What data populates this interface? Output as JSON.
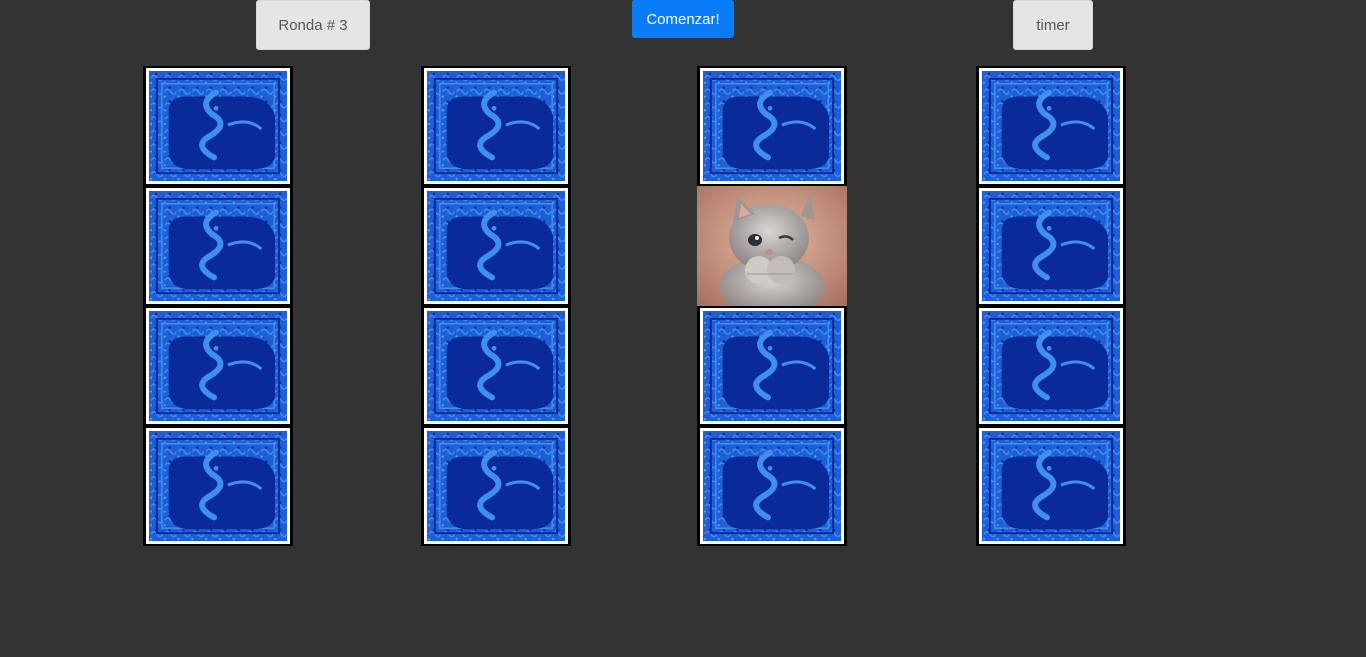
{
  "header": {
    "round_label": "Ronda # 3",
    "start_label": "Comenzar!",
    "timer_label": "timer"
  },
  "colors": {
    "background": "#333333",
    "card_back_base": "#1f5fd6",
    "card_back_dark": "#0a2a9a",
    "card_back_light": "#3f8ff0",
    "primary": "#0a7cf7"
  },
  "board": {
    "columns": 4,
    "rows": 4,
    "cards": [
      {
        "col": 1,
        "row": 1,
        "state": "face-down",
        "icon": "card-back-cat-pattern"
      },
      {
        "col": 1,
        "row": 2,
        "state": "face-down",
        "icon": "card-back-cat-pattern"
      },
      {
        "col": 1,
        "row": 3,
        "state": "face-down",
        "icon": "card-back-cat-pattern"
      },
      {
        "col": 1,
        "row": 4,
        "state": "face-down",
        "icon": "card-back-cat-pattern"
      },
      {
        "col": 2,
        "row": 1,
        "state": "face-down",
        "icon": "card-back-cat-pattern"
      },
      {
        "col": 2,
        "row": 2,
        "state": "face-down",
        "icon": "card-back-cat-pattern"
      },
      {
        "col": 2,
        "row": 3,
        "state": "face-down",
        "icon": "card-back-cat-pattern"
      },
      {
        "col": 2,
        "row": 4,
        "state": "face-down",
        "icon": "card-back-cat-pattern"
      },
      {
        "col": 3,
        "row": 1,
        "state": "face-down",
        "icon": "card-back-cat-pattern"
      },
      {
        "col": 3,
        "row": 2,
        "state": "face-up",
        "icon": "kitten-photo"
      },
      {
        "col": 3,
        "row": 3,
        "state": "face-down",
        "icon": "card-back-cat-pattern"
      },
      {
        "col": 3,
        "row": 4,
        "state": "face-down",
        "icon": "card-back-cat-pattern"
      },
      {
        "col": 4,
        "row": 1,
        "state": "face-down",
        "icon": "card-back-cat-pattern"
      },
      {
        "col": 4,
        "row": 2,
        "state": "face-down",
        "icon": "card-back-cat-pattern"
      },
      {
        "col": 4,
        "row": 3,
        "state": "face-down",
        "icon": "card-back-cat-pattern"
      },
      {
        "col": 4,
        "row": 4,
        "state": "face-down",
        "icon": "card-back-cat-pattern"
      }
    ]
  }
}
